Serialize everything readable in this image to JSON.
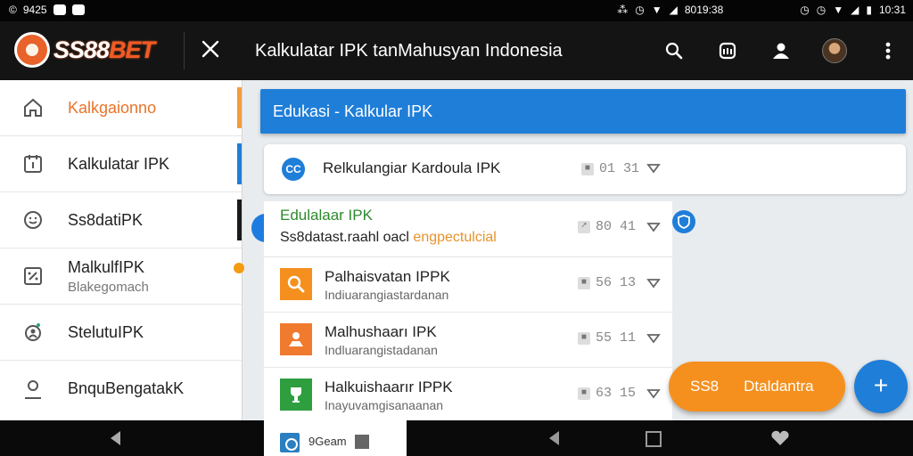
{
  "statusbar": {
    "left_time": "9425",
    "right_middle": "8019:38",
    "right_time": "10:31"
  },
  "app": {
    "brand": "SS88BET",
    "title": "Kalkulatar IPK tanMahusyan Indonesia"
  },
  "sidebar": {
    "items": [
      {
        "label": "Kalkgaionno",
        "sub": "",
        "icon": "home-icon",
        "marker_color": "#f39c3a",
        "active": true
      },
      {
        "label": "Kalkulatar IPK",
        "sub": "",
        "icon": "calendar-icon",
        "marker_color": "#1f7ed8"
      },
      {
        "label": "Ss8datiPK",
        "sub": "",
        "icon": "smile-icon",
        "marker_color": "#1a1a1a"
      },
      {
        "label": "MalkulfIPK",
        "sub": "Blakegomach",
        "icon": "percent-icon"
      },
      {
        "label": "StelutuIPK",
        "sub": "",
        "icon": "chart-person-icon"
      },
      {
        "label": "BnquBengatakK",
        "sub": "",
        "icon": "user-icon"
      }
    ]
  },
  "breadcrumb": "Edukasi - Kalkular IPK",
  "card": {
    "icon_text": "CC",
    "title": "Relkulangiar Kardoula IPK",
    "meta": "01 31"
  },
  "list_header": {
    "title": "Edulalaar IPK",
    "sub_plain": "Ss8datast.raahl oacl ",
    "sub_accent": "engpectulcial",
    "meta": "80 41"
  },
  "rows": [
    {
      "title": "Palhaisvatan IPPK",
      "sub": "Indiuarangiastardanan",
      "meta": "56 13",
      "icon": "search-icon",
      "color": "#f5901e"
    },
    {
      "title": "Malhushaarı IPK",
      "sub": "Indluarangistadanan",
      "meta": "55 11",
      "icon": "person-tile-icon",
      "color": "#f07a2e"
    },
    {
      "title": "Halkuishaarır IPPK",
      "sub": "Inayuvamgisanaanan",
      "meta": "63 15",
      "icon": "trophy-icon",
      "color": "#2e9e3f"
    }
  ],
  "fab_pill": {
    "label1": "SS8",
    "label2": "Dtaldantra"
  },
  "fab": {
    "label": "+"
  },
  "bottom_sheet": {
    "text": "9Geam"
  }
}
